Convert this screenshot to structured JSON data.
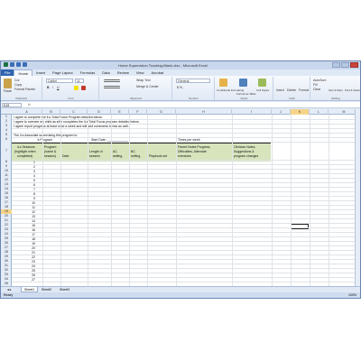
{
  "window": {
    "title": "Home Supervision Tracking-Blank.xlsx - Microsoft Excel"
  },
  "tabs": [
    "File",
    "Home",
    "Insert",
    "Page Layout",
    "Formulas",
    "Data",
    "Review",
    "View",
    "Acrobat"
  ],
  "ribbon": {
    "paste": "Paste",
    "cut": "Cut",
    "copy": "Copy",
    "format_painter": "Format Painter",
    "clipboard": "Clipboard",
    "font_name": "Calibri",
    "font_size": "11",
    "font": "Font",
    "wrap_text": "Wrap Text",
    "merge_center": "Merge & Center",
    "alignment": "Alignment",
    "number_format": "General",
    "number": "Number",
    "cond_fmt": "Conditional Formatting",
    "fmt_table": "Format as Table",
    "cell_styles": "Cell Styles",
    "styles": "Styles",
    "insert": "Insert",
    "delete": "Delete",
    "format": "Format",
    "cells": "Cells",
    "autosum": "AutoSum",
    "fill": "Fill",
    "clear": "Clear",
    "sort_filter": "Sort & Filter",
    "find_select": "Find & Select",
    "editing": "Editing"
  },
  "name_box": "K19",
  "columns": [
    "A",
    "B",
    "C",
    "D",
    "E",
    "F",
    "G",
    "H",
    "I",
    "J",
    "K",
    "L",
    "M"
  ],
  "rows": [
    "1",
    "2",
    "3",
    "4",
    "5",
    "6",
    "7",
    "8",
    "9",
    "10",
    "11",
    "12",
    "13",
    "14",
    "15",
    "16",
    "17",
    "18",
    "19",
    "20",
    "21",
    "22",
    "23",
    "24",
    "25",
    "26",
    "27",
    "28",
    "29",
    "30",
    "31",
    "32",
    "33",
    "34",
    "35"
  ],
  "content": {
    "r1": "I agree to complete the iLs Total Focus Program detailed below.",
    "r2": "I agree to oversee my child as s/he completes the iLs Total Focus program detailed below.",
    "r3": "I agree report progress at least once a week and will add comments below as well.",
    "r5": "The iLs Associate supervising this program is:",
    "r6_program": "'s Program",
    "r6_start": "Start Date: ____________",
    "r6_times": "Times per week",
    "headers": {
      "sessions": [
        "iLs Sessions",
        "(highlight when",
        "completed)"
      ],
      "program": [
        "Program",
        "(name &",
        "session)"
      ],
      "date": "Date",
      "length": [
        "Length of",
        "session"
      ],
      "ac": [
        "AC",
        "setting"
      ],
      "bc": [
        "BC",
        "setting"
      ],
      "playbook": "Playbook set",
      "parent": [
        "Parent Notes Progress,",
        "Difficulties, Alternate",
        "exercises"
      ],
      "clinician": [
        "Clinician Notes,",
        "Suggestions &",
        "program changes"
      ]
    },
    "session_numbers": [
      "1",
      "2",
      "3",
      "4",
      "5",
      "6",
      "7",
      "8",
      "9",
      "10",
      "11",
      "12",
      "13",
      "14",
      "15",
      "16",
      "17",
      "18",
      "19",
      "20",
      "21",
      "22",
      "23",
      "24",
      "25",
      "26",
      "27"
    ]
  },
  "sheets": [
    "Sheet1",
    "Sheet2",
    "Sheet3"
  ],
  "status": "Ready",
  "zoom": "100%"
}
